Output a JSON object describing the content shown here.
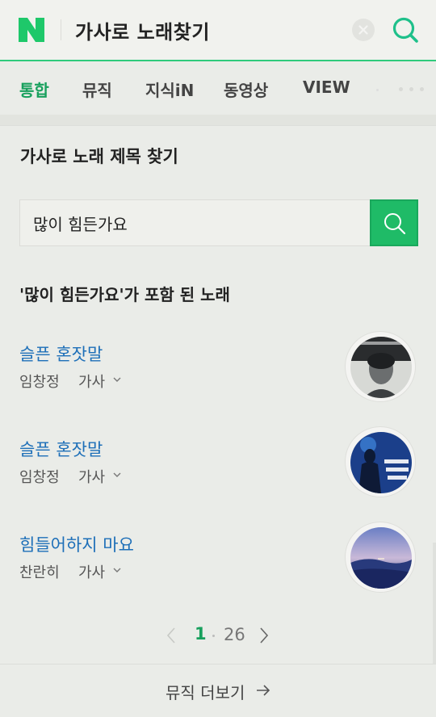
{
  "header": {
    "logo_letter": "N",
    "query": "가사로 노래찾기",
    "brand_color": "#1ec800"
  },
  "tabs": [
    {
      "label": "통합",
      "active": true
    },
    {
      "label": "뮤직",
      "active": false
    },
    {
      "label": "지식iN",
      "active": false
    },
    {
      "label": "동영상",
      "active": false
    },
    {
      "label": "VIEW",
      "active": false
    }
  ],
  "section": {
    "title": "가사로 노래 제목 찾기",
    "search_value": "많이 힘든가요",
    "results_caption": "'많이 힘든가요'가 포함 된 노래"
  },
  "songs": [
    {
      "title": "슬픈 혼잣말",
      "artist": "임창정",
      "lyrics_label": "가사"
    },
    {
      "title": "슬픈 혼잣말",
      "artist": "임창정",
      "lyrics_label": "가사"
    },
    {
      "title": "힘들어하지 마요",
      "artist": "찬란히",
      "lyrics_label": "가사"
    }
  ],
  "pager": {
    "current": "1",
    "total": "26"
  },
  "footer": {
    "more_label": "뮤직 더보기"
  },
  "colors": {
    "accent": "#18a05d",
    "link": "#1d6fb8",
    "search_button": "#1fbb67"
  }
}
